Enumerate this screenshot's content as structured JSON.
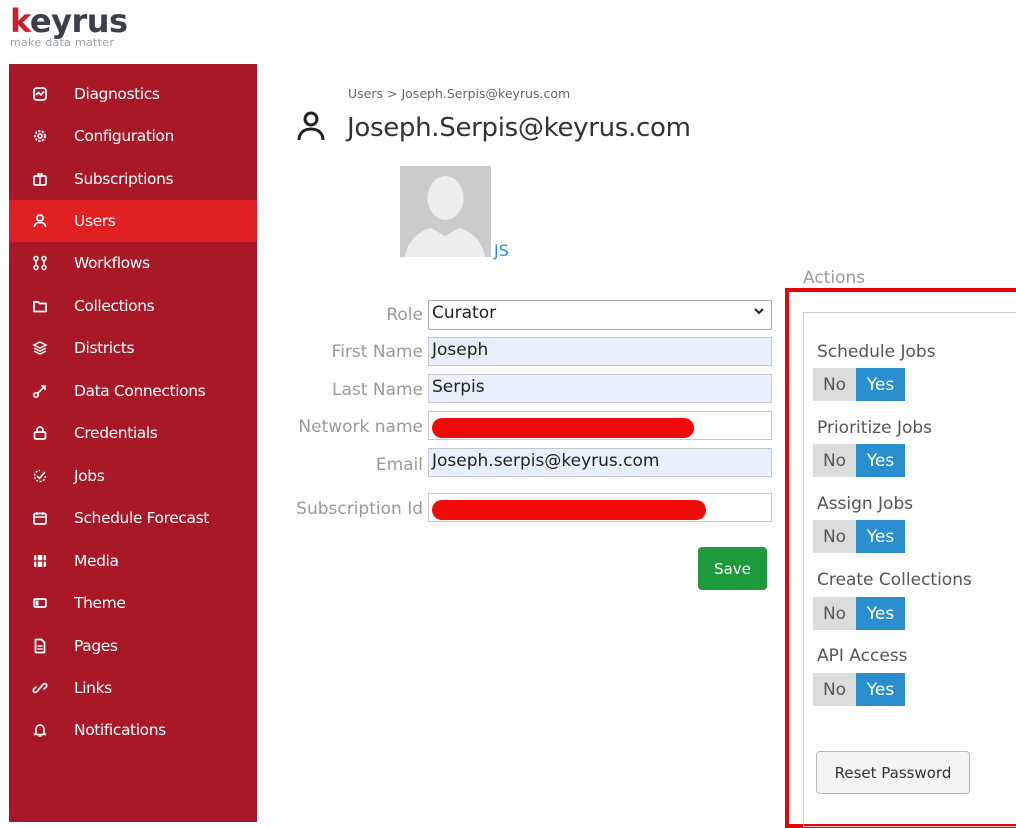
{
  "logo": {
    "word_k": "k",
    "word_rest": "eyrus",
    "tagline": "make data matter"
  },
  "sidebar": {
    "items": [
      {
        "label": "Diagnostics",
        "icon": "diagnostics-icon"
      },
      {
        "label": "Configuration",
        "icon": "gear-icon"
      },
      {
        "label": "Subscriptions",
        "icon": "subscriptions-icon"
      },
      {
        "label": "Users",
        "icon": "user-icon",
        "active": true
      },
      {
        "label": "Workflows",
        "icon": "workflow-icon"
      },
      {
        "label": "Collections",
        "icon": "folder-icon"
      },
      {
        "label": "Districts",
        "icon": "layers-icon"
      },
      {
        "label": "Data Connections",
        "icon": "link-arrow-icon"
      },
      {
        "label": "Credentials",
        "icon": "lock-icon"
      },
      {
        "label": "Jobs",
        "icon": "check-circle-icon"
      },
      {
        "label": "Schedule Forecast",
        "icon": "calendar-icon"
      },
      {
        "label": "Media",
        "icon": "film-icon"
      },
      {
        "label": "Theme",
        "icon": "theme-icon"
      },
      {
        "label": "Pages",
        "icon": "page-icon"
      },
      {
        "label": "Links",
        "icon": "chain-link-icon"
      },
      {
        "label": "Notifications",
        "icon": "bell-icon"
      }
    ]
  },
  "breadcrumb": {
    "root": "Users",
    "separator": ">",
    "current": "Joseph.Serpis@keyrus.com"
  },
  "page_title": "Joseph.Serpis@keyrus.com",
  "avatar": {
    "initials": "JS"
  },
  "form": {
    "role": {
      "label": "Role",
      "value": "Curator"
    },
    "first_name": {
      "label": "First Name",
      "value": "Joseph"
    },
    "last_name": {
      "label": "Last Name",
      "value": "Serpis"
    },
    "network_name": {
      "label": "Network name"
    },
    "email": {
      "label": "Email",
      "value": "Joseph.serpis@keyrus.com"
    },
    "subscription_id": {
      "label": "Subscription Id"
    },
    "save_label": "Save"
  },
  "actions": {
    "title": "Actions",
    "items": [
      {
        "label": "Schedule Jobs",
        "no": "No",
        "yes": "Yes",
        "value": "Yes"
      },
      {
        "label": "Prioritize Jobs",
        "no": "No",
        "yes": "Yes",
        "value": "Yes"
      },
      {
        "label": "Assign Jobs",
        "no": "No",
        "yes": "Yes",
        "value": "Yes"
      },
      {
        "label": "Create Collections",
        "no": "No",
        "yes": "Yes",
        "value": "Yes"
      },
      {
        "label": "API Access",
        "no": "No",
        "yes": "Yes",
        "value": "Yes"
      }
    ],
    "reset_password_label": "Reset Password"
  },
  "colors": {
    "sidebar": "#a91827",
    "active": "#e12024",
    "yes": "#2a8fcf",
    "save": "#1d9a3b",
    "highlight": "#e8000a"
  }
}
